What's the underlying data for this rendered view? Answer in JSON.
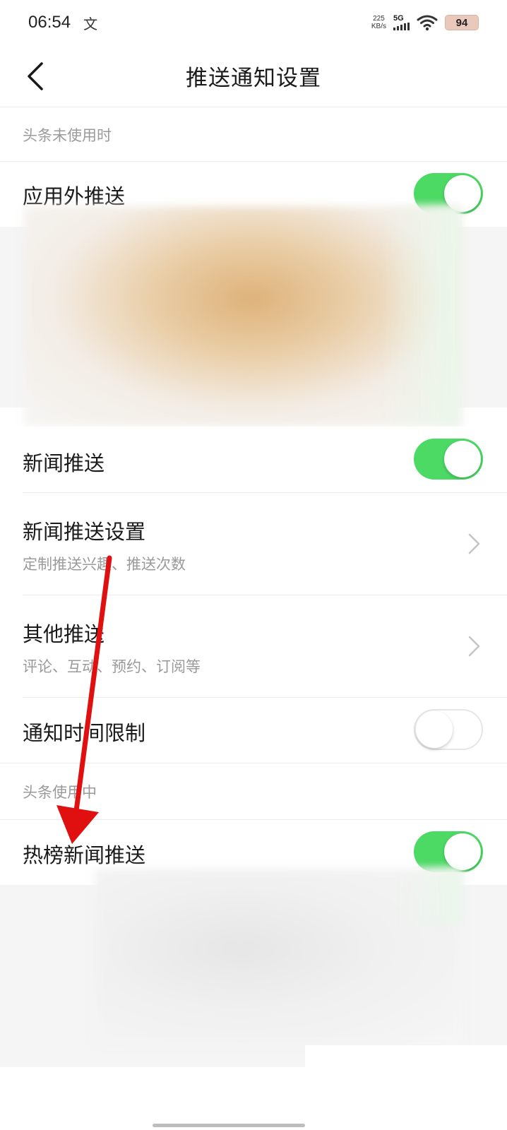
{
  "status_bar": {
    "time": "06:54",
    "mini_icon": "文",
    "speed_value": "225",
    "speed_unit": "KB/s",
    "network": "5G",
    "battery": "94"
  },
  "header": {
    "title": "推送通知设置"
  },
  "sections": {
    "unused": "头条未使用时",
    "in_use": "头条使用中"
  },
  "rows": {
    "out_app_push": {
      "label": "应用外推送",
      "on": true
    },
    "news_push": {
      "label": "新闻推送",
      "on": true
    },
    "news_push_settings": {
      "label": "新闻推送设置",
      "sub": "定制推送兴趣、推送次数"
    },
    "other_push": {
      "label": "其他推送",
      "sub": "评论、互动、预约、订阅等"
    },
    "notify_time_limit": {
      "label": "通知时间限制",
      "on": false
    },
    "hot_list_push": {
      "label": "热榜新闻推送",
      "on": true
    }
  },
  "colors": {
    "toggle_on": "#4cd964",
    "arrow": "#e01010"
  },
  "icons": {
    "back": "chevron-left-icon",
    "row_nav": "chevron-right-icon"
  }
}
